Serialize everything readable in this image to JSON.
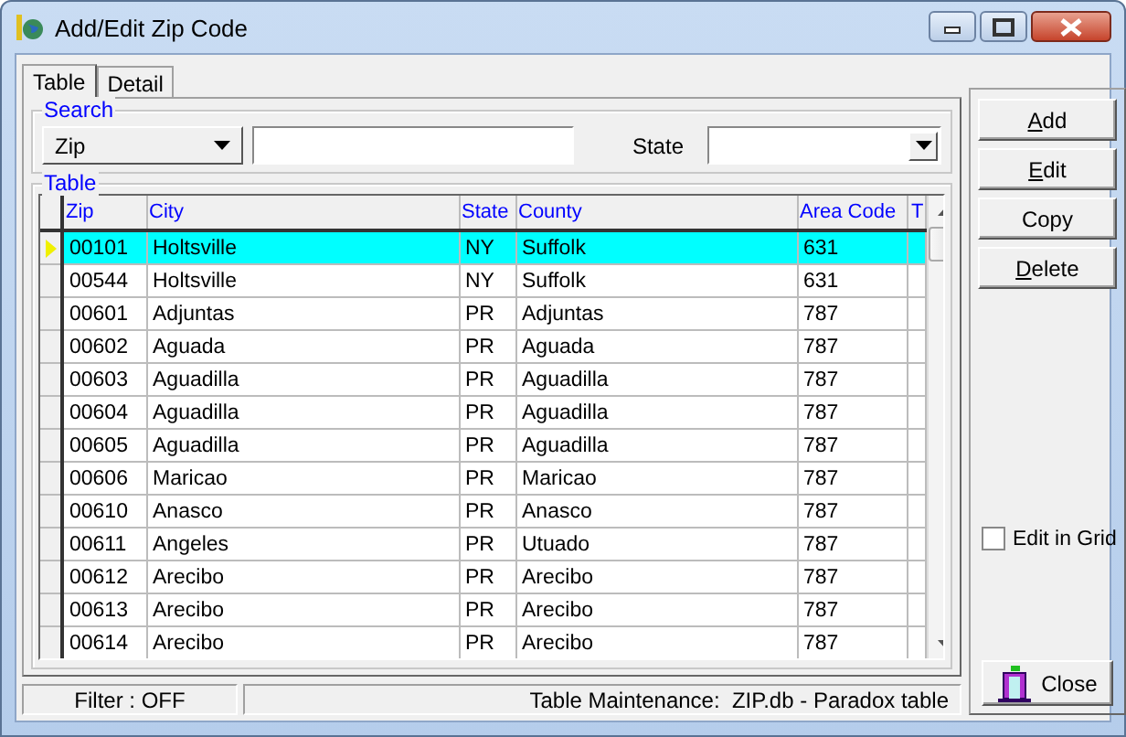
{
  "window": {
    "title": "Add/Edit Zip Code"
  },
  "tabs": [
    {
      "label": "Table",
      "selected": true
    },
    {
      "label": "Detail",
      "selected": false
    }
  ],
  "search": {
    "title": "Search",
    "field_choice": "Zip",
    "state_label": "State"
  },
  "table": {
    "title": "Table",
    "columns": [
      "Zip",
      "City",
      "State",
      "County",
      "Area Code",
      "T"
    ],
    "rows": [
      {
        "selected": true,
        "cells": [
          "00101",
          "Holtsville",
          "NY",
          "Suffolk",
          "631"
        ]
      },
      {
        "selected": false,
        "cells": [
          "00544",
          "Holtsville",
          "NY",
          "Suffolk",
          "631"
        ]
      },
      {
        "selected": false,
        "cells": [
          "00601",
          "Adjuntas",
          "PR",
          "Adjuntas",
          "787"
        ]
      },
      {
        "selected": false,
        "cells": [
          "00602",
          "Aguada",
          "PR",
          "Aguada",
          "787"
        ]
      },
      {
        "selected": false,
        "cells": [
          "00603",
          "Aguadilla",
          "PR",
          "Aguadilla",
          "787"
        ]
      },
      {
        "selected": false,
        "cells": [
          "00604",
          "Aguadilla",
          "PR",
          "Aguadilla",
          "787"
        ]
      },
      {
        "selected": false,
        "cells": [
          "00605",
          "Aguadilla",
          "PR",
          "Aguadilla",
          "787"
        ]
      },
      {
        "selected": false,
        "cells": [
          "00606",
          "Maricao",
          "PR",
          "Maricao",
          "787"
        ]
      },
      {
        "selected": false,
        "cells": [
          "00610",
          "Anasco",
          "PR",
          "Anasco",
          "787"
        ]
      },
      {
        "selected": false,
        "cells": [
          "00611",
          "Angeles",
          "PR",
          "Utuado",
          "787"
        ]
      },
      {
        "selected": false,
        "cells": [
          "00612",
          "Arecibo",
          "PR",
          "Arecibo",
          "787"
        ]
      },
      {
        "selected": false,
        "cells": [
          "00613",
          "Arecibo",
          "PR",
          "Arecibo",
          "787"
        ]
      },
      {
        "selected": false,
        "cells": [
          "00614",
          "Arecibo",
          "PR",
          "Arecibo",
          "787"
        ]
      }
    ]
  },
  "buttons": [
    {
      "label": "Add",
      "mnemonic": true
    },
    {
      "label": "Edit",
      "mnemonic": true
    },
    {
      "label": "Copy",
      "mnemonic": false
    },
    {
      "label": "Delete",
      "mnemonic": true
    }
  ],
  "edit_in_grid": {
    "label": "Edit in Grid",
    "checked": false
  },
  "close_button": {
    "label": "Close"
  },
  "status_bar": {
    "filter": "Filter : OFF",
    "info": "Table Maintenance:  ZIP.db - Paradox table"
  }
}
